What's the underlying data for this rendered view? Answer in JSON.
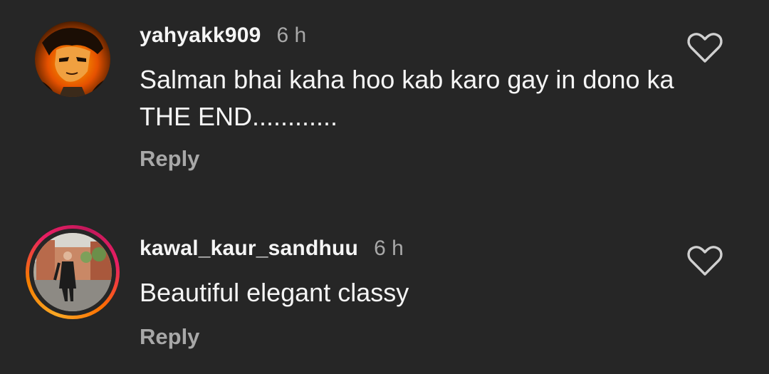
{
  "comments": [
    {
      "username": "yahyakk909",
      "time": "6 h",
      "text": "Salman bhai kaha hoo kab karo gay in dono ka THE END............",
      "reply_label": "Reply",
      "avatar_icon": "anime-character-avatar",
      "has_story_ring": false
    },
    {
      "username": "kawal_kaur_sandhuu",
      "time": "6 h",
      "text": "Beautiful elegant classy",
      "reply_label": "Reply",
      "avatar_icon": "person-photo-avatar",
      "has_story_ring": true
    }
  ],
  "colors": {
    "background": "#262626",
    "primary_text": "#f5f5f5",
    "secondary_text": "#a8a8a8",
    "ring_start": "#f9a825",
    "ring_end": "#c2185b"
  },
  "icons": {
    "like": "heart-outline-icon"
  }
}
